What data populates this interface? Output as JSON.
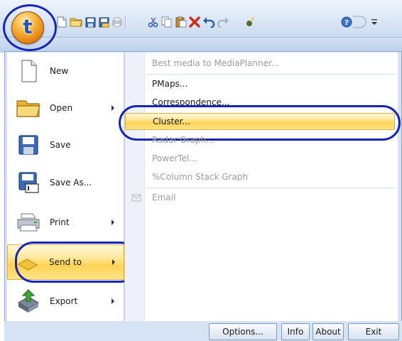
{
  "app": {
    "orb_letter": "t"
  },
  "qat": {
    "icons": [
      "new-file-icon",
      "open-folder-icon",
      "save-icon",
      "save-as-icon",
      "print-icon",
      "cut-icon",
      "copy-icon",
      "paste-icon",
      "delete-icon",
      "undo-icon",
      "redo-icon",
      "run-icon",
      "help-icon",
      "customize-icon"
    ]
  },
  "left_menu": {
    "items": [
      {
        "label": "New",
        "icon": "new-document-icon",
        "arrow": false
      },
      {
        "label": "Open",
        "icon": "open-folder-icon",
        "arrow": true
      },
      {
        "label": "Save",
        "icon": "save-icon",
        "arrow": false
      },
      {
        "label": "Save As...",
        "icon": "save-as-icon",
        "arrow": false
      },
      {
        "label": "Print",
        "icon": "printer-icon",
        "arrow": true
      },
      {
        "label": "Send to",
        "icon": "send-icon",
        "arrow": true
      },
      {
        "label": "Export",
        "icon": "export-icon",
        "arrow": true
      }
    ]
  },
  "submenu": {
    "items": [
      {
        "label": "Best media to MediaPlanner...",
        "disabled": true
      },
      {
        "label": "PMaps...",
        "disabled": false
      },
      {
        "label": "Correspondence...",
        "disabled": false
      },
      {
        "label": "Cluster...",
        "disabled": false,
        "highlighted": true
      },
      {
        "label": "Radar Graph...",
        "disabled": true
      },
      {
        "label": "PowerTel...",
        "disabled": true
      },
      {
        "label": "%Column Stack Graph",
        "disabled": true
      },
      {
        "label": "Email",
        "disabled": true
      }
    ]
  },
  "footer": {
    "options_label": "Options...",
    "info_label": "Info",
    "about_label": "About",
    "exit_label": "Exit"
  },
  "colors": {
    "highlight": "#ffd354",
    "annotation_ring": "#1626b8",
    "frame": "#d6e3f4"
  }
}
